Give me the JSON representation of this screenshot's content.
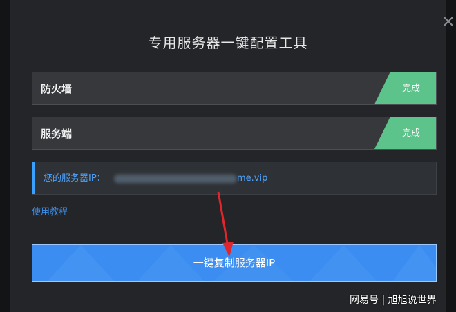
{
  "dialog": {
    "title": "专用服务器一键配置工具"
  },
  "rows": [
    {
      "label": "防火墙",
      "status": "完成"
    },
    {
      "label": "服务端",
      "status": "完成"
    }
  ],
  "ip": {
    "label": "您的服务器IP：",
    "value_visible": "me.vip"
  },
  "tutorial_link": "使用教程",
  "primary_button": "一键复制服务器IP",
  "watermark": "网易号 | 旭旭说世界",
  "colors": {
    "done_badge": "#5cc38a",
    "primary": "#3b8df1",
    "link": "#3d8ee8",
    "arrow": "#e0262b"
  }
}
